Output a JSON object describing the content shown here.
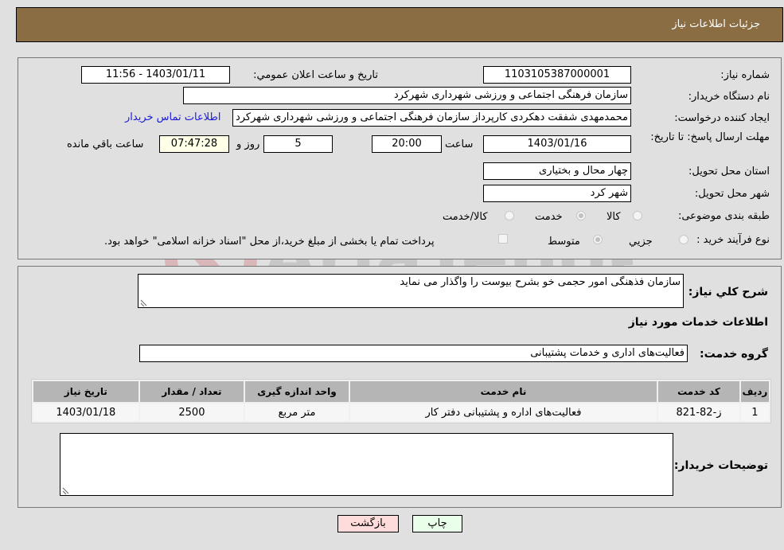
{
  "header": {
    "title": "جزئیات اطلاعات نیاز"
  },
  "form": {
    "need_number": {
      "label": "شماره نیاز:",
      "value": "1103105387000001"
    },
    "announce_datetime": {
      "label": "تاریخ و ساعت اعلان عمومي:",
      "value": "1403/01/11 - 11:56"
    },
    "buyer_org": {
      "label": "نام دستگاه خریدار:",
      "value": "سازمان فرهنگی   اجتماعی و ورزشی شهرداری شهرکرد"
    },
    "requester": {
      "label": "ایجاد کننده درخواست:",
      "value": "محمدمهدی شفقت دهکردی کارپرداز سازمان فرهنگی   اجتماعی و ورزشی شهرداری شهرکرد"
    },
    "contact_link": "اطلاعات تماس خریدار",
    "deadline": {
      "label": "مهلت ارسال پاسخ: تا تاریخ:",
      "date": "1403/01/16",
      "time_label": "ساعت",
      "time": "20:00",
      "days": "5",
      "days_label": "روز و",
      "remaining": "07:47:28",
      "remaining_label": "ساعت باقي مانده"
    },
    "province": {
      "label": "استان محل تحویل:",
      "value": "چهار محال و بختیاری"
    },
    "city": {
      "label": "شهر محل تحویل:",
      "value": "شهر کرد"
    },
    "category": {
      "label": "طبقه بندی موضوعی:",
      "options": [
        {
          "label": "کالا",
          "checked": false
        },
        {
          "label": "خدمت",
          "checked": true
        },
        {
          "label": "کالا/خدمت",
          "checked": false
        }
      ]
    },
    "purchase_type": {
      "label": "نوع فرآیند خرید :",
      "options": [
        {
          "label": "جزيي",
          "checked": false
        },
        {
          "label": "متوسط",
          "checked": true
        }
      ],
      "treasury_note": "پرداخت تمام یا بخشی از مبلغ خرید،از محل \"اسناد خزانه اسلامی\" خواهد بود.",
      "treasury_checked": false
    }
  },
  "details": {
    "description_label": "شرح کلي نياز:",
    "description": "سازمان فذهنگی امور حجمی خو بشرح بیوست را واگذار می نماید",
    "services_title": "اطلاعات خدمات مورد نیاز",
    "service_group_label": "گروه خدمت:",
    "service_group": "فعالیت‌های اداری و خدمات پشتیبانی",
    "table": {
      "headers": [
        "ردیف",
        "کد خدمت",
        "نام خدمت",
        "واحد اندازه گیری",
        "تعداد / مقدار",
        "تاریخ نیاز"
      ],
      "rows": [
        [
          "1",
          "ز-82-821",
          "فعالیت‌های اداره و پشتیبانی دفتر کار",
          "متر مربع",
          "2500",
          "1403/01/18"
        ]
      ]
    },
    "buyer_notes_label": "توضیحات خریدار:",
    "buyer_notes": ""
  },
  "buttons": {
    "print": "چاپ",
    "back": "بازگشت"
  },
  "colors": {
    "header_bg": "#8b6d44",
    "print_bg": "#eaffea",
    "back_bg": "#ffdcdc",
    "link": "#1a1adb"
  }
}
